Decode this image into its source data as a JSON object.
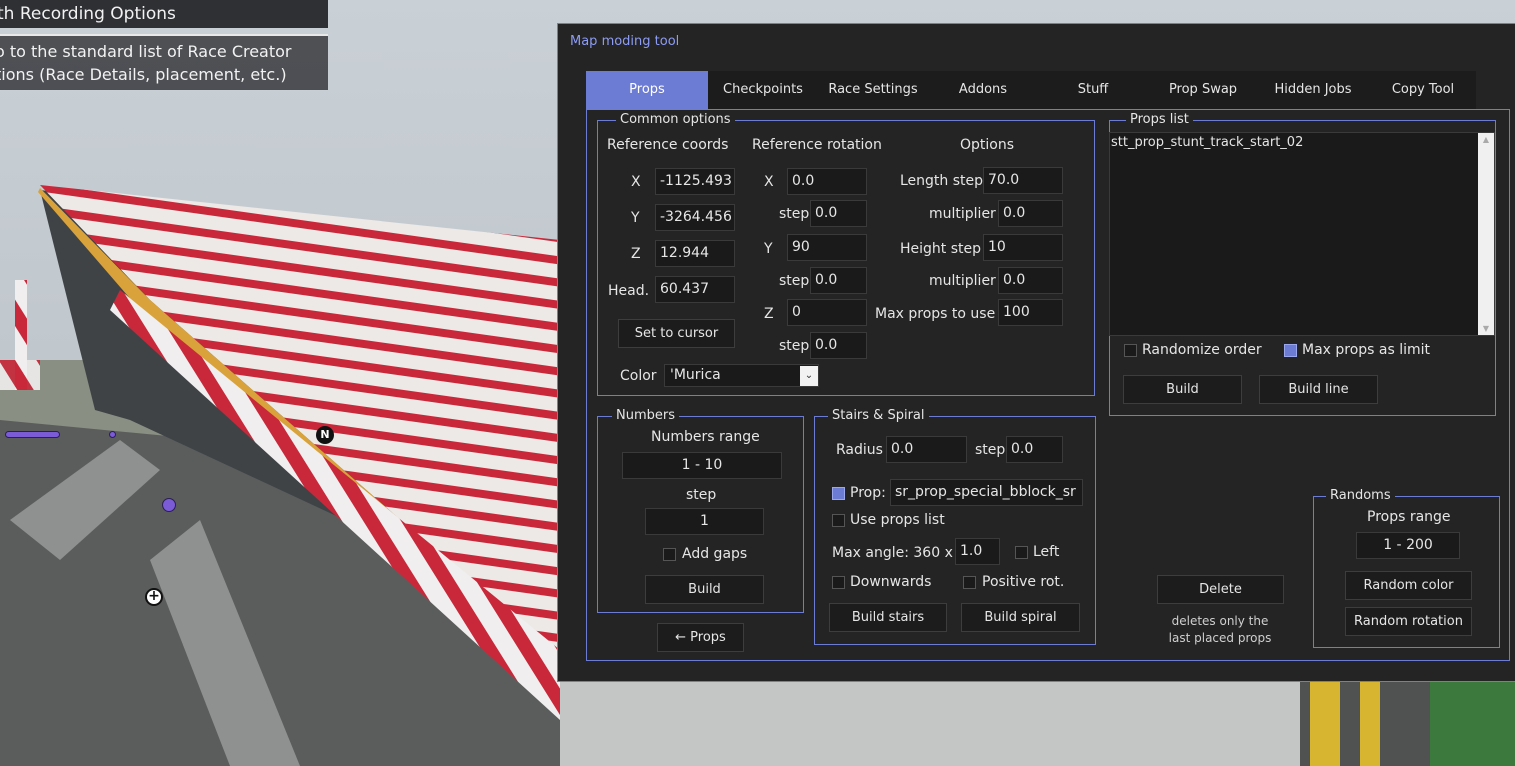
{
  "hud": {
    "header": "th Recording Options",
    "desc_line1": "o to the standard list of Race Creator",
    "desc_line2": "tions (Race Details, placement, etc.)",
    "marker": "N"
  },
  "window": {
    "title": "Map moding tool"
  },
  "tabs": [
    "Props",
    "Checkpoints",
    "Race Settings",
    "Addons",
    "Stuff",
    "Prop Swap",
    "Hidden Jobs",
    "Copy Tool"
  ],
  "active_tab": "Props",
  "common": {
    "legend": "Common options",
    "ref_coords": "Reference coords",
    "ref_rotation": "Reference rotation",
    "options": "Options",
    "x_label": "X",
    "y_label": "Y",
    "z_label": "Z",
    "head_label": "Head.",
    "x": "-1125.493",
    "y": "-3264.456",
    "z": "12.944",
    "head": "60.437",
    "set_to_cursor": "Set to cursor",
    "rot_x": "0.0",
    "rot_y": "90",
    "rot_z": "0",
    "step_label": "step",
    "rot_x_step": "0.0",
    "rot_y_step": "0.0",
    "rot_z_step": "0.0",
    "length_step_label": "Length step",
    "length_step": "70.0",
    "multiplier_label": "multiplier",
    "length_mult": "0.0",
    "height_step_label": "Height step",
    "height_step": "10",
    "height_mult": "0.0",
    "max_props_label": "Max props to use",
    "max_props": "100",
    "color_label": "Color",
    "color_value": "'Murica"
  },
  "props_list": {
    "legend": "Props list",
    "items": [
      "stt_prop_stunt_track_start_02"
    ],
    "randomize_order": "Randomize order",
    "max_props_as_limit": "Max props as limit",
    "build": "Build",
    "build_line": "Build line"
  },
  "numbers": {
    "legend": "Numbers",
    "range_label": "Numbers range",
    "range": "1 - 10",
    "step_label": "step",
    "step": "1",
    "add_gaps": "Add gaps",
    "build": "Build"
  },
  "back_props": "← Props",
  "stairs": {
    "legend": "Stairs & Spiral",
    "radius_label": "Radius",
    "radius": "0.0",
    "step_label": "step",
    "step": "0.0",
    "prop_label": "Prop:",
    "prop_value": "sr_prop_special_bblock_sr",
    "use_props_list": "Use props list",
    "max_angle_label": "Max angle: 360 x",
    "max_angle": "1.0",
    "left": "Left",
    "downwards": "Downwards",
    "positive_rot": "Positive rot.",
    "build_stairs": "Build stairs",
    "build_spiral": "Build spiral"
  },
  "delete": {
    "button": "Delete",
    "note1": "deletes only the",
    "note2": "last placed props"
  },
  "randoms": {
    "legend": "Randoms",
    "range_label": "Props range",
    "range": "1 - 200",
    "random_color": "Random color",
    "random_rotation": "Random rotation"
  },
  "colors": {
    "accent": "#6c7bd4",
    "window_bg": "#242424",
    "field_bg": "#1a1a1a"
  }
}
